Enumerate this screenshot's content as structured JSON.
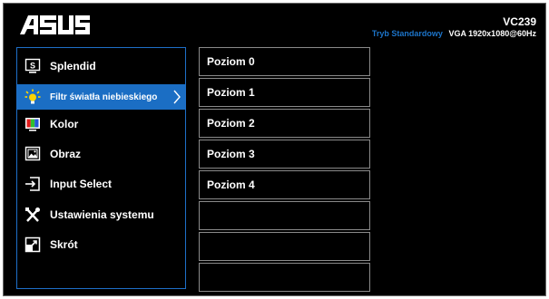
{
  "header": {
    "brand": "ASUS",
    "model": "VC239",
    "mode": "Tryb Standardowy",
    "input": "VGA",
    "resolution": "1920x1080@60Hz",
    "accent_color": "#1c74c9"
  },
  "main_menu": {
    "items": [
      {
        "label": "Splendid",
        "icon": "splendid-icon"
      },
      {
        "label": "Filtr światła niebieskiego",
        "icon": "bulb-icon",
        "selected": true
      },
      {
        "label": "Kolor",
        "icon": "color-icon"
      },
      {
        "label": "Obraz",
        "icon": "image-icon"
      },
      {
        "label": "Input Select",
        "icon": "input-select-icon"
      },
      {
        "label": "Ustawienia systemu",
        "icon": "tools-icon"
      },
      {
        "label": "Skrót",
        "icon": "shortcut-icon"
      }
    ]
  },
  "sub_menu": {
    "items": [
      {
        "label": "Poziom 0"
      },
      {
        "label": "Poziom 1"
      },
      {
        "label": "Poziom 2"
      },
      {
        "label": "Poziom 3"
      },
      {
        "label": "Poziom 4"
      },
      {
        "label": ""
      },
      {
        "label": ""
      },
      {
        "label": ""
      }
    ]
  }
}
